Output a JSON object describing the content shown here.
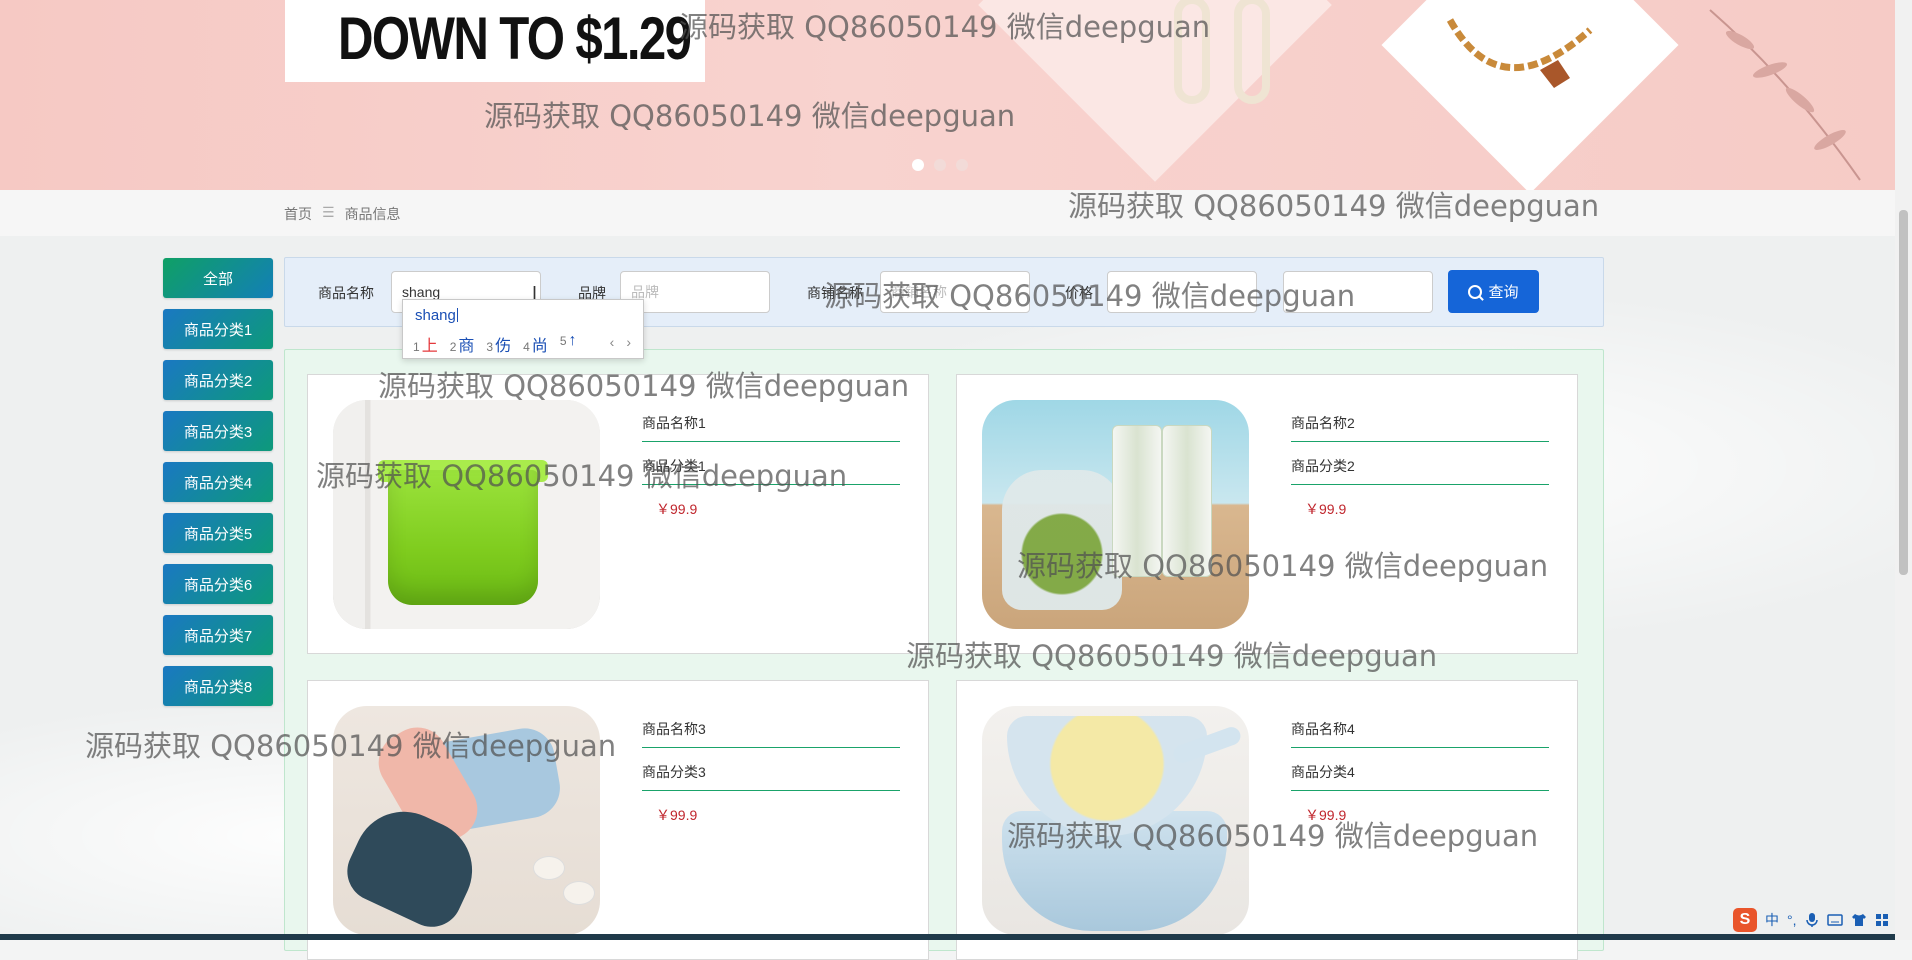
{
  "banner": {
    "promo_text": "DOWN TO $1.29",
    "slides": [
      {
        "active": true
      },
      {
        "active": false
      },
      {
        "active": false
      }
    ]
  },
  "breadcrumb": {
    "home": "首页",
    "separator": "☰",
    "current": "商品信息"
  },
  "sidebar": {
    "items": [
      "全部",
      "商品分类1",
      "商品分类2",
      "商品分类3",
      "商品分类4",
      "商品分类5",
      "商品分类6",
      "商品分类7",
      "商品分类8"
    ]
  },
  "search": {
    "name_label": "商品名称",
    "name_value": "shang",
    "brand_label": "品牌",
    "brand_placeholder": "品牌",
    "shop_label": "商铺名称",
    "shop_placeholder": "商铺名称",
    "price_label": "价格",
    "price_min_placeholder": "",
    "price_max_placeholder": "",
    "button_label": "查询",
    "button_icon": "search-icon"
  },
  "ime": {
    "composition": "shang",
    "candidates": [
      {
        "num": "1",
        "text": "上"
      },
      {
        "num": "2",
        "text": "商"
      },
      {
        "num": "3",
        "text": "伤"
      },
      {
        "num": "4",
        "text": "尚"
      },
      {
        "num": "5",
        "text": "↑"
      }
    ],
    "prev": "‹",
    "next": "›"
  },
  "products": [
    {
      "name": "商品名称1",
      "category": "商品分类1",
      "price": "￥99.9",
      "image": "green-bin"
    },
    {
      "name": "商品名称2",
      "category": "商品分类2",
      "price": "￥99.9",
      "image": "food-bags"
    },
    {
      "name": "商品名称3",
      "category": "商品分类3",
      "price": "￥99.9",
      "image": "vegetable-slicer"
    },
    {
      "name": "商品名称4",
      "category": "商品分类4",
      "price": "￥99.9",
      "image": "colander-basin"
    }
  ],
  "watermark": "源码获取 QQ86050149 微信deepguan",
  "imebar": {
    "logo": "S",
    "lang": "中",
    "punct": "°,",
    "icons": [
      "mic-icon",
      "keyboard-icon",
      "shirt-icon",
      "grid-icon"
    ]
  },
  "colors": {
    "accent": "#1565d8",
    "green": "#1aa36a",
    "price": "#c0262d"
  }
}
